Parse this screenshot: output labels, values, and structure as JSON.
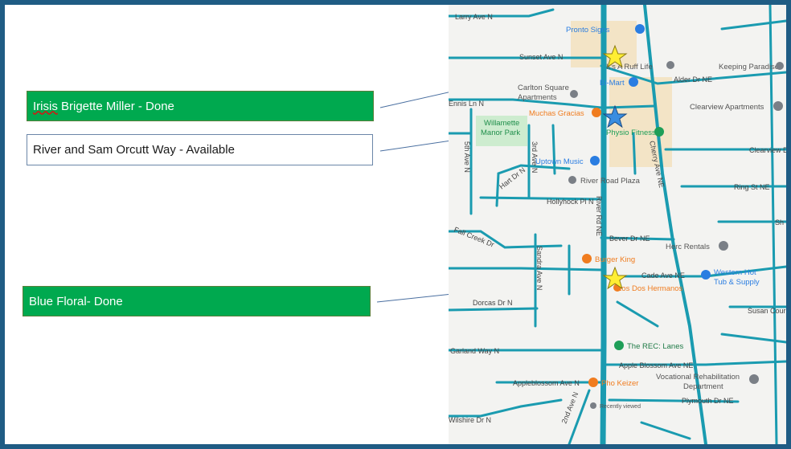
{
  "colors": {
    "frame_border": "#1f5c84",
    "done_fill": "#00a94f",
    "available_fill": "#ffffff",
    "road": "#1a9bb0",
    "map_bg": "#f3f3f1",
    "park": "#cdeccf",
    "commercial": "#f3e4c6",
    "star_yellow": "#ffee33",
    "star_blue": "#3a8de0",
    "poi_blue": "#2a7de1",
    "poi_orange": "#f07c1f",
    "poi_green": "#1e9e58",
    "poi_grey": "#7a7f86"
  },
  "callouts": [
    {
      "name_part": "Irisis",
      "text": "Brigette Miller - Done",
      "status": "done"
    },
    {
      "text": "River and Sam Orcutt Way - Available",
      "status": "available"
    },
    {
      "text": "Blue Floral- Done",
      "status": "done"
    }
  ],
  "map": {
    "streets": [
      "Larry Ave N",
      "Sunset Ave N",
      "Alder Dr NE",
      "Ennis Ln N",
      "Cherry Ave NE",
      "Clearview Dr",
      "5th Ave N",
      "3rd Ave N",
      "Hart Dr N",
      "Hollyhock Pl N",
      "Ring St NE",
      "River Rd NE",
      "Fall Creek Dr",
      "Bever Dr NE",
      "Sandra Ave N",
      "Cade Ave NE",
      "Dorcas Dr N",
      "Garland Way N",
      "Apple Blossom Ave NE",
      "Appleblossom Ave N",
      "2nd Ave N",
      "Plymouth Dr NE",
      "Wilshire Dr N",
      "Sh",
      "Susan Cour"
    ],
    "places": {
      "pronto_signs": "Pronto Signs",
      "ruff_life": "It's A Ruff Life",
      "keeping_paradise": "Keeping Paradise",
      "bimart": "Bi-Mart",
      "carlton_square_1": "Carlton Square",
      "carlton_square_2": "Apartments",
      "muchas_gracias": "Muchas Gracias",
      "clearview_apts": "Clearview Apartments",
      "willamette_1": "Willamette",
      "willamette_2": "Manor Park",
      "physio_fitness": "Physio Fitness",
      "uptown_music": "Uptown Music",
      "river_road_plaza": "River Road Plaza",
      "herc_rentals": "Herc Rentals",
      "burger_king": "Burger King",
      "western_hot_1": "Western Hot",
      "western_hot_2": "Tub & Supply",
      "los_dos": "Los Dos Hermanos",
      "rec_lanes": "The REC: Lanes",
      "vocational_1": "Vocational Rehabilitation",
      "vocational_2": "Department",
      "pho_keizer": "Pho Keizer",
      "recently_viewed": "Recently viewed"
    }
  },
  "pins": [
    {
      "icon": "star",
      "color": "yellow",
      "for": "Irisis Brigette Miller - Done"
    },
    {
      "icon": "star",
      "color": "blue",
      "for": "River and Sam Orcutt Way - Available"
    },
    {
      "icon": "star",
      "color": "yellow",
      "for": "Blue Floral- Done"
    }
  ]
}
